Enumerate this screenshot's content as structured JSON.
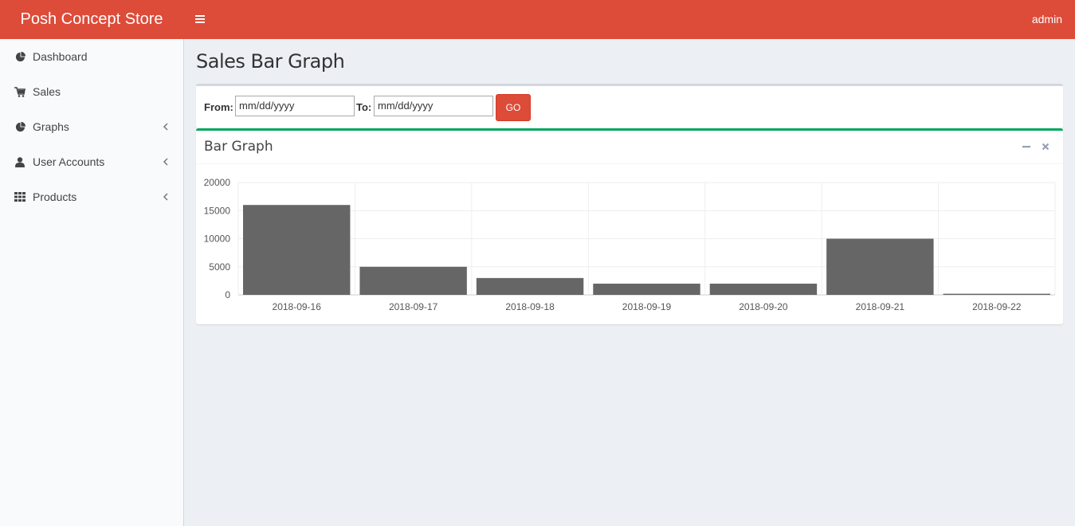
{
  "header": {
    "brand": "Posh Concept Store",
    "user": "admin",
    "accent_color": "#dd4b39"
  },
  "sidebar": {
    "items": [
      {
        "label": "Dashboard",
        "icon": "pie-chart-icon",
        "has_submenu": false
      },
      {
        "label": "Sales",
        "icon": "cart-icon",
        "has_submenu": false
      },
      {
        "label": "Graphs",
        "icon": "pie-chart-icon",
        "has_submenu": true
      },
      {
        "label": "User Accounts",
        "icon": "user-icon",
        "has_submenu": true
      },
      {
        "label": "Products",
        "icon": "grid-icon",
        "has_submenu": true
      }
    ]
  },
  "page": {
    "title": "Sales Bar Graph"
  },
  "filter": {
    "from_label": "From:",
    "from_value": "mm/dd/yyyy",
    "to_label": "To:",
    "to_value": "mm/dd/yyyy",
    "go_label": "GO"
  },
  "chart_box": {
    "title": "Bar Graph",
    "accent_color": "#00a65a"
  },
  "chart_data": {
    "type": "bar",
    "categories": [
      "2018-09-16",
      "2018-09-17",
      "2018-09-18",
      "2018-09-19",
      "2018-09-20",
      "2018-09-21",
      "2018-09-22"
    ],
    "values": [
      16000,
      5000,
      3000,
      2000,
      2000,
      10000,
      200
    ],
    "yticks": [
      0,
      5000,
      10000,
      15000,
      20000
    ],
    "ylim": [
      0,
      20000
    ],
    "bar_color": "#666666",
    "grid": true
  }
}
